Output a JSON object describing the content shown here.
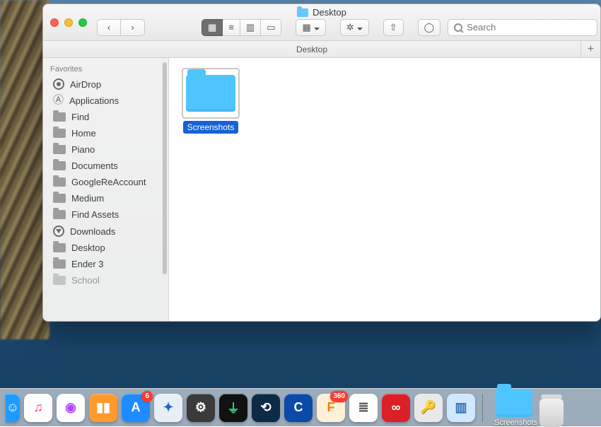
{
  "window": {
    "title": "Desktop",
    "tab_label": "Desktop",
    "search_placeholder": "Search"
  },
  "sidebar": {
    "section": "Favorites",
    "items": [
      {
        "label": "AirDrop",
        "icon": "airdrop"
      },
      {
        "label": "Applications",
        "icon": "apps"
      },
      {
        "label": "Find",
        "icon": "folder"
      },
      {
        "label": "Home",
        "icon": "folder"
      },
      {
        "label": "Piano",
        "icon": "folder"
      },
      {
        "label": "Documents",
        "icon": "folder"
      },
      {
        "label": "GoogleReAccount",
        "icon": "folder"
      },
      {
        "label": "Medium",
        "icon": "folder"
      },
      {
        "label": "Find Assets",
        "icon": "folder"
      },
      {
        "label": "Downloads",
        "icon": "downloads"
      },
      {
        "label": "Desktop",
        "icon": "folder"
      },
      {
        "label": "Ender 3",
        "icon": "folder"
      },
      {
        "label": "School",
        "icon": "folder"
      }
    ]
  },
  "content": {
    "items": [
      {
        "name": "Screenshots",
        "selected": true
      }
    ]
  },
  "dock": {
    "apps": [
      {
        "name": "finder",
        "bg": "#1e9bff",
        "glyph": "☺",
        "half": true
      },
      {
        "name": "itunes",
        "bg": "#ffffff",
        "glyph": "♫",
        "fg": "#fc3d6b"
      },
      {
        "name": "podcasts",
        "bg": "#ffffff",
        "glyph": "◉",
        "fg": "#b646ff"
      },
      {
        "name": "books",
        "bg": "#ff9a2e",
        "glyph": "▮▮"
      },
      {
        "name": "appstore",
        "bg": "#1f8bff",
        "glyph": "A",
        "badge": "6"
      },
      {
        "name": "safari",
        "bg": "#e8eef6",
        "glyph": "✦",
        "fg": "#1866d0"
      },
      {
        "name": "system-prefs",
        "bg": "#3a3a3a",
        "glyph": "⚙"
      },
      {
        "name": "activity",
        "bg": "#111111",
        "glyph": "⏚",
        "fg": "#33d17a"
      },
      {
        "name": "steam",
        "bg": "#0a2a45",
        "glyph": "⟲"
      },
      {
        "name": "cura",
        "bg": "#0a4aa8",
        "glyph": "C"
      },
      {
        "name": "fusion360",
        "bg": "#fff0d8",
        "glyph": "F",
        "fg": "#ff7a00",
        "badge": "360"
      },
      {
        "name": "textedit",
        "bg": "#ffffff",
        "glyph": "≣",
        "fg": "#555"
      },
      {
        "name": "creative-cloud",
        "bg": "#da1f26",
        "glyph": "∞"
      },
      {
        "name": "keychain",
        "bg": "#e9e9e9",
        "glyph": "🔑",
        "fg": "#b08a3a"
      },
      {
        "name": "preview",
        "bg": "#cfe7ff",
        "glyph": "▥",
        "fg": "#2e6fb3"
      }
    ],
    "right": {
      "folder_label": "Screenshots"
    }
  }
}
